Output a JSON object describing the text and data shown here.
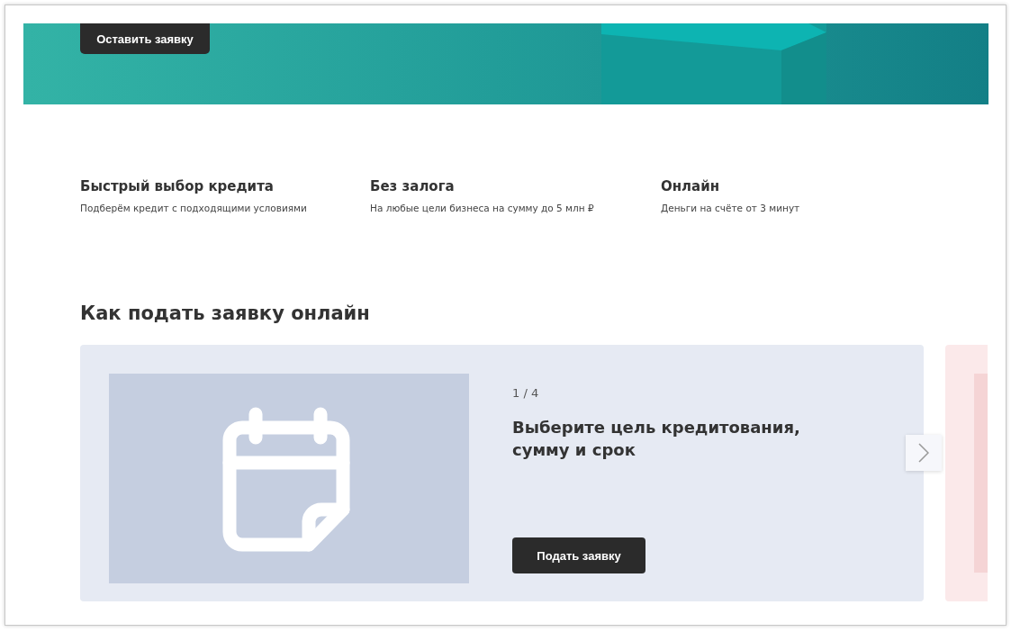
{
  "banner": {
    "button": "Оставить заявку"
  },
  "features": [
    {
      "title": "Быстрый выбор кредита",
      "text": "Подберём кредит с подходящими условиями"
    },
    {
      "title": "Без залога",
      "text": "На любые цели бизнеса на сумму до 5 млн ₽"
    },
    {
      "title": "Онлайн",
      "text": "Деньги на счёте от 3 минут"
    }
  ],
  "steps": {
    "heading": "Как подать заявку онлайн",
    "counter": "1 / 4",
    "title": "Выберите цель кредитования, сумму и срок",
    "button": "Подать заявку"
  }
}
